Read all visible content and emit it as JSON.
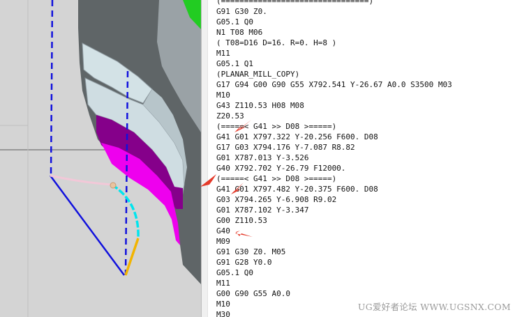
{
  "code_panel": {
    "lines": [
      "(================================)",
      "G91 G30 Z0.",
      "G05.1 Q0",
      "N1 T08 M06",
      "( T08=D16 D=16. R=0. H=8 )",
      "M11",
      "G05.1 Q1",
      "(PLANAR_MILL_COPY)",
      "G17 G94 G00 G90 G55 X792.541 Y-26.67 A0.0 S3500 M03",
      "M10",
      "G43 Z110.53 H08 M08",
      "Z20.53",
      "(=====< G41 >> D08 >=====)",
      "G41 G01 X797.322 Y-20.256 F600. D08",
      "G17 G03 X794.176 Y-7.087 R8.82",
      "G01 X787.013 Y-3.526",
      "G40 X792.702 Y-26.79 F12000.",
      "(=====< G41 >> D08 >=====)",
      "G41 G01 X797.482 Y-20.375 F600. D08",
      "G03 X794.265 Y-6.908 R9.02",
      "G01 X787.102 Y-3.347",
      "G00 Z110.53",
      "G40",
      "M09",
      "G91 G30 Z0. M05",
      "G91 G28 Y0.0",
      "G05.1 Q0",
      "M11",
      "G00 G90 G55 A0.0",
      "M10",
      "M30"
    ]
  },
  "watermark": "UG爱好者论坛 WWW.UGSNX.COM",
  "colors": {
    "viewport_bg": "#d4d4d4",
    "part_gray": "#5f6567",
    "wall_light": "#d3e2e6",
    "purple": "#85008a",
    "magenta": "#ee00ee",
    "green": "#22cc22",
    "toolpath_blue": "#1111dd",
    "arc_cyan": "#00e5ee",
    "lead_pink": "#f2c8d8",
    "exit_orange": "#f2b400",
    "arrow_red": "#e53a2a"
  }
}
